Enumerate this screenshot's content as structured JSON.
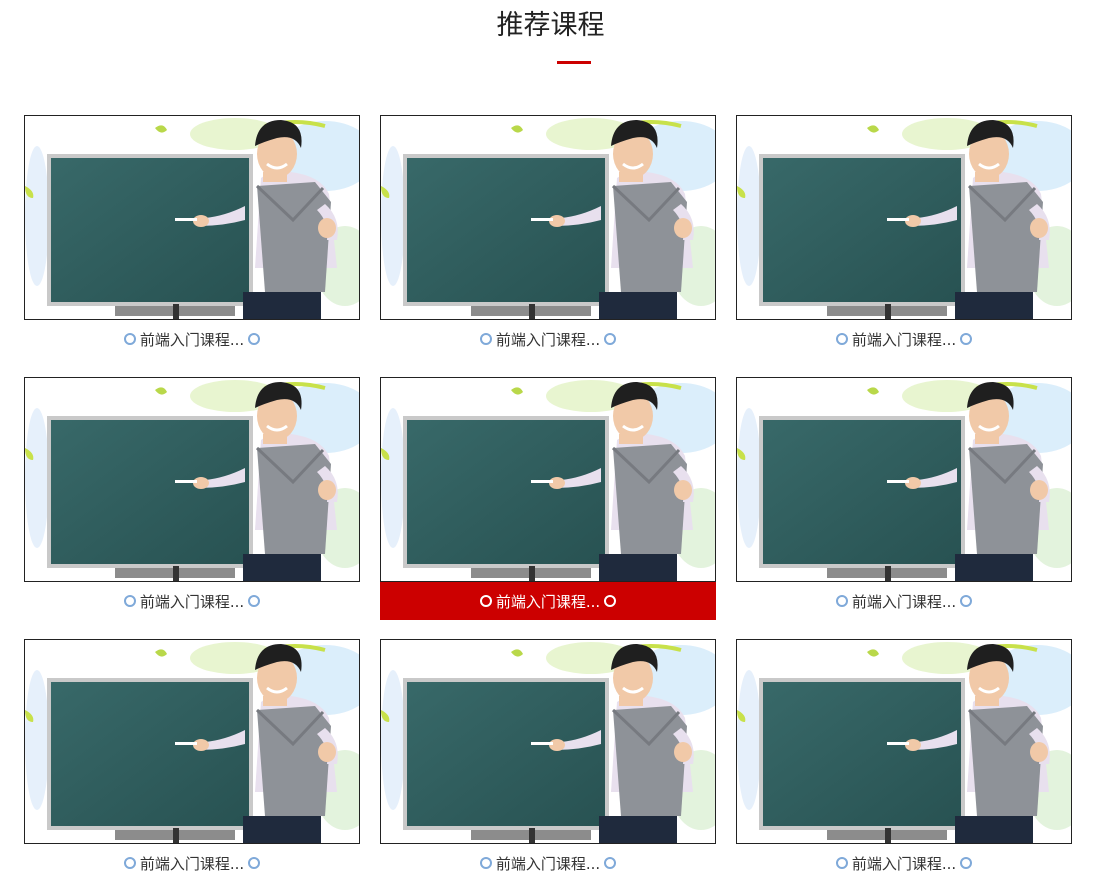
{
  "section": {
    "title": "推荐课程",
    "accent_color": "#cc0000"
  },
  "courses": [
    {
      "title": "前端入门课程...",
      "image": "teacher-at-chalkboard",
      "active": false
    },
    {
      "title": "前端入门课程...",
      "image": "teacher-at-chalkboard",
      "active": false
    },
    {
      "title": "前端入门课程...",
      "image": "teacher-at-chalkboard",
      "active": false
    },
    {
      "title": "前端入门课程...",
      "image": "teacher-at-chalkboard",
      "active": false
    },
    {
      "title": "前端入门课程...",
      "image": "teacher-at-chalkboard",
      "active": true
    },
    {
      "title": "前端入门课程...",
      "image": "teacher-at-chalkboard",
      "active": false
    },
    {
      "title": "前端入门课程...",
      "image": "teacher-at-chalkboard",
      "active": false
    },
    {
      "title": "前端入门课程...",
      "image": "teacher-at-chalkboard",
      "active": false
    },
    {
      "title": "前端入门课程...",
      "image": "teacher-at-chalkboard",
      "active": false
    }
  ]
}
